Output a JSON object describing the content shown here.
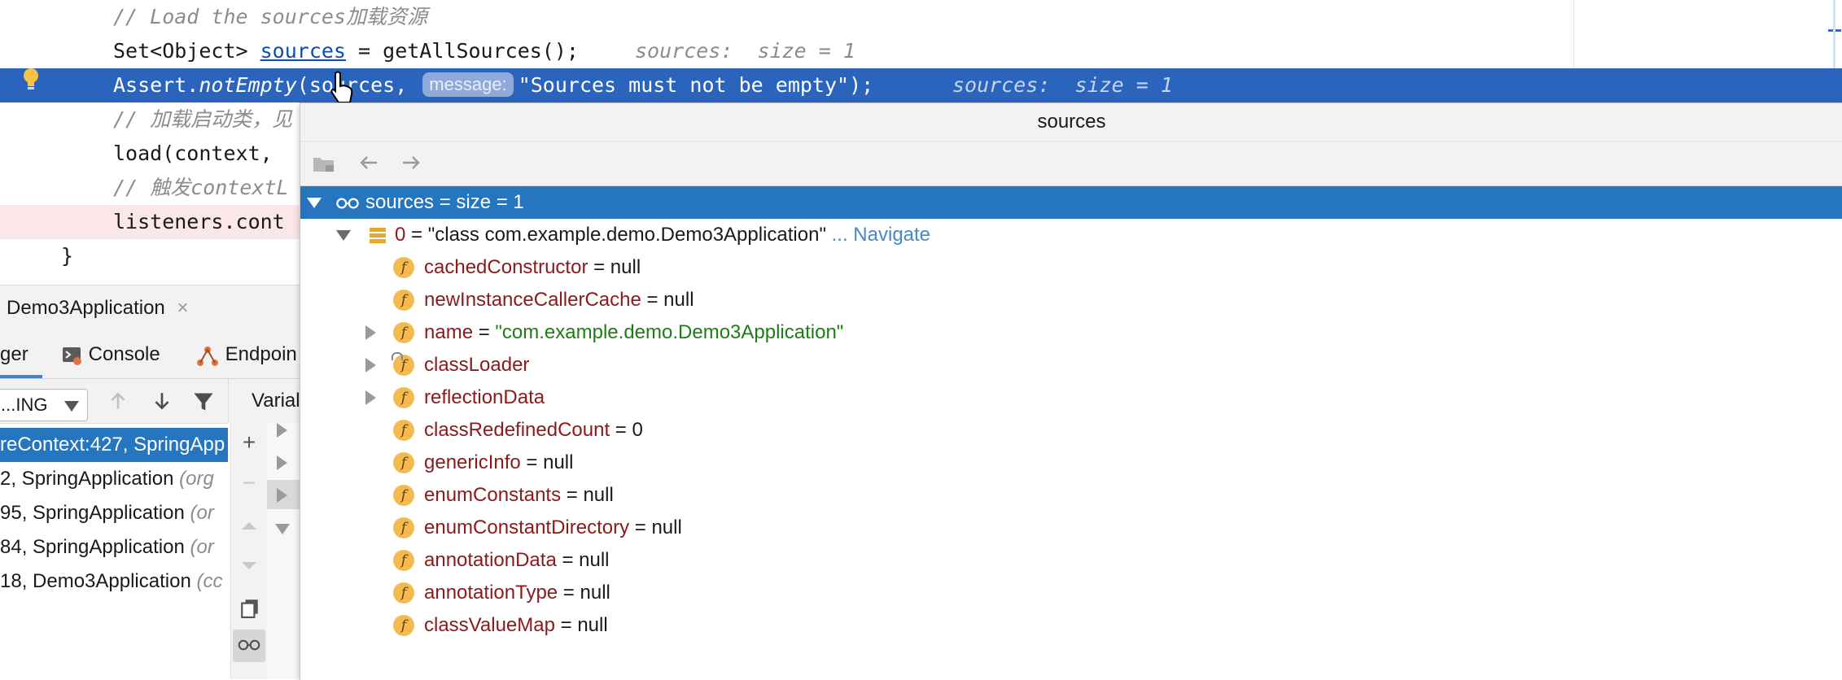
{
  "editor": {
    "line1_comment": "// Load the sources加载资源",
    "line2_code_a": "Set<Object> ",
    "line2_var": "sources",
    "line2_code_b": " = getAllSources();",
    "line2_hint": "sources:  size = 1",
    "line3_code_a": "Assert.",
    "line3_method": "notEmpty",
    "line3_code_b": "(sources, ",
    "line3_param_hint": "message:",
    "line3_code_c": "\"Sources must not be empty\");",
    "line3_hint": "sources:  size = 1",
    "line4_comment": "// 加载启动类，见",
    "line5_code": "load(context, ",
    "line6_comment": "// 触发contextL",
    "line7_code": "listeners.cont",
    "line8_code": "}"
  },
  "tool_window": {
    "run_tab_label": "Demo3Application",
    "close_glyph": "×",
    "tabs": [
      "ger",
      "Console",
      "Endpoin"
    ],
    "variables_header": "Varial",
    "thread_select_value": "...ING",
    "frames": [
      {
        "text": "reContext:427, SpringApp",
        "pkg": ""
      },
      {
        "text": "2, SpringApplication ",
        "pkg": "(org"
      },
      {
        "text": "95, SpringApplication ",
        "pkg": "(or"
      },
      {
        "text": "84, SpringApplication ",
        "pkg": "(or"
      },
      {
        "text": "18, Demo3Application ",
        "pkg": "(cc"
      }
    ]
  },
  "popup": {
    "title": "sources",
    "root": {
      "name": "sources",
      "value": " =  size = 1"
    },
    "element": {
      "index": "0",
      "value": " = \"class com.example.demo.Demo3Application\"",
      "navigate": " ... Navigate"
    },
    "fields": [
      {
        "name": "cachedConstructor",
        "value": " = null",
        "expandable": false
      },
      {
        "name": "newInstanceCallerCache",
        "value": " = null",
        "expandable": false
      },
      {
        "name": "name",
        "value": " = ",
        "str": "\"com.example.demo.Demo3Application\"",
        "expandable": true
      },
      {
        "name": "classLoader",
        "value": "",
        "expandable": true
      },
      {
        "name": "reflectionData",
        "value": "",
        "expandable": true
      },
      {
        "name": "classRedefinedCount",
        "value": " = 0",
        "expandable": false
      },
      {
        "name": "genericInfo",
        "value": " = null",
        "expandable": false
      },
      {
        "name": "enumConstants",
        "value": " = null",
        "expandable": false
      },
      {
        "name": "enumConstantDirectory",
        "value": " = null",
        "expandable": false
      },
      {
        "name": "annotationData",
        "value": " = null",
        "expandable": false
      },
      {
        "name": "annotationType",
        "value": " = null",
        "expandable": false
      },
      {
        "name": "classValueMap",
        "value": " = null",
        "expandable": false
      }
    ],
    "field_badge": "f"
  },
  "colors": {
    "exec_line": "#2b64bd",
    "selection": "#2675bf",
    "field_badge": "#f4ba52",
    "string_value": "#1e7d14"
  }
}
